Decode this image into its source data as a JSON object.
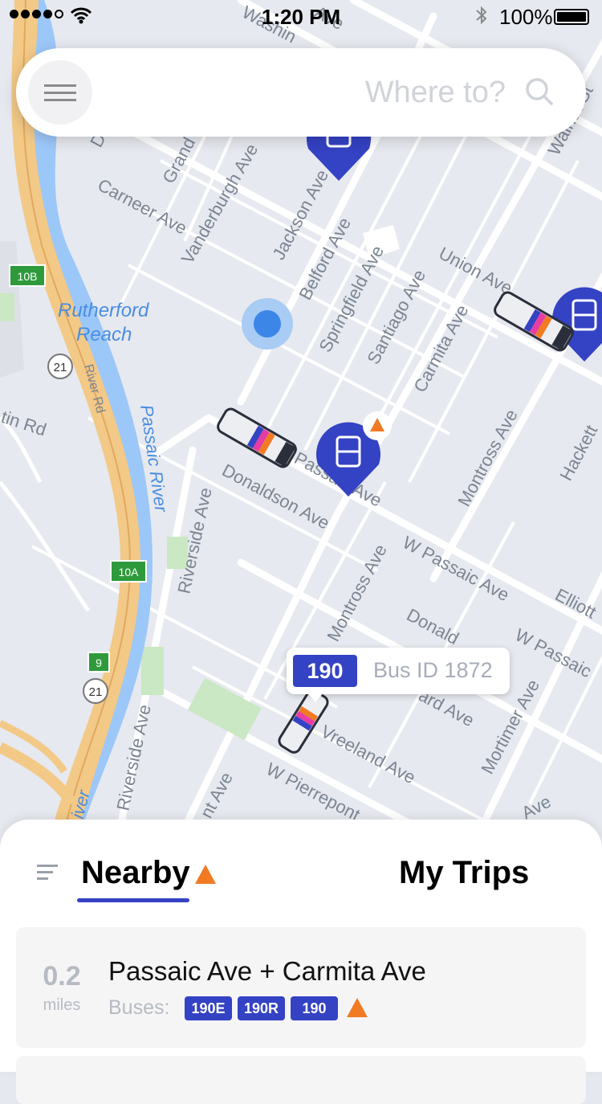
{
  "status_bar": {
    "time": "1:20 PM",
    "battery": "100%"
  },
  "search": {
    "placeholder": "Where to?"
  },
  "map": {
    "streets": [
      "Carneer Ave",
      "Vanderburgh Ave",
      "Jackson Ave",
      "Belford Ave",
      "Springfield Ave",
      "Santiago Ave",
      "Carmita Ave",
      "Union Ave",
      "Montross Ave",
      "Hackett",
      "Walnut St",
      "Grand",
      "W Passaic Ave",
      "Donaldson Ave",
      "Riverside Ave",
      "River Rd",
      "Passaic River",
      "Elliott",
      "Mortimer Ave",
      "Vreeland Ave",
      "W Pierrepont",
      "Passaic Ave",
      "Montross Ave",
      "Donald",
      "Washington",
      "Rutherford Reach",
      "tin Rd"
    ],
    "highway_labels": [
      "10B",
      "21",
      "10A",
      "9",
      "21"
    ]
  },
  "bus_tip": {
    "route": "190",
    "bus_id": "Bus ID 1872"
  },
  "sheet": {
    "tabs": [
      {
        "label": "Nearby"
      },
      {
        "label": "My Trips"
      }
    ],
    "stop": {
      "distance": "0.2",
      "unit": "miles",
      "name": "Passaic Ave + Carmita Ave",
      "buses_label": "Buses:",
      "routes": [
        "190E",
        "190R",
        "190"
      ]
    }
  },
  "colors": {
    "accent": "#3442c4",
    "alert": "#f07b23",
    "water": "#9cc7f9",
    "highway": "#f3c987"
  }
}
